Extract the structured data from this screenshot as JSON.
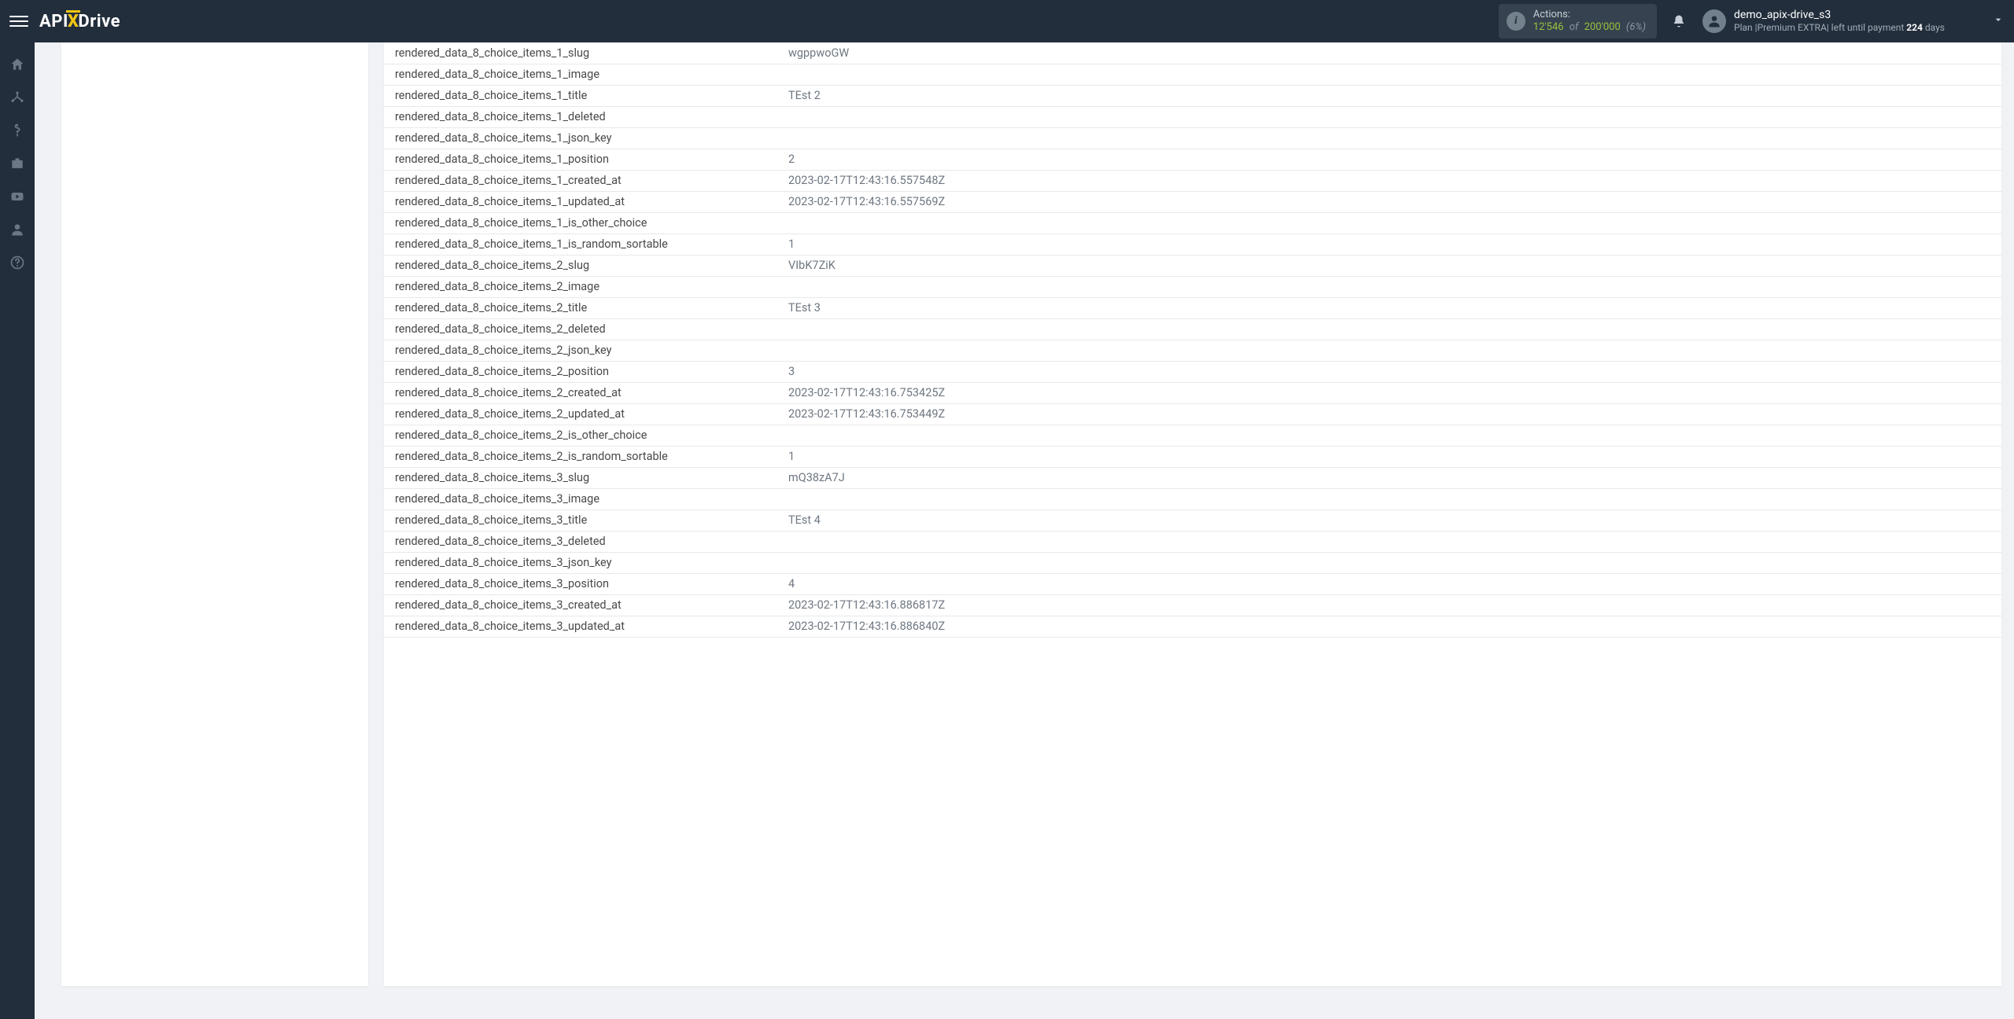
{
  "header": {
    "logo": {
      "api": "API",
      "x": "X",
      "drive": "Drive"
    },
    "actions": {
      "label": "Actions:",
      "count": "12'546",
      "of": "of",
      "total": "200'000",
      "pct": "(6%)"
    },
    "user": {
      "name": "demo_apix-drive_s3",
      "plan_prefix": "Plan |",
      "plan_name": "Premium EXTRA",
      "plan_suffix": "| left until payment ",
      "days_num": "224",
      "days_word": " days"
    }
  },
  "rows": [
    {
      "key": "rendered_data_8_choice_items_1_slug",
      "value": "wgppwoGW"
    },
    {
      "key": "rendered_data_8_choice_items_1_image",
      "value": ""
    },
    {
      "key": "rendered_data_8_choice_items_1_title",
      "value": "TEst 2"
    },
    {
      "key": "rendered_data_8_choice_items_1_deleted",
      "value": ""
    },
    {
      "key": "rendered_data_8_choice_items_1_json_key",
      "value": ""
    },
    {
      "key": "rendered_data_8_choice_items_1_position",
      "value": "2"
    },
    {
      "key": "rendered_data_8_choice_items_1_created_at",
      "value": "2023-02-17T12:43:16.557548Z"
    },
    {
      "key": "rendered_data_8_choice_items_1_updated_at",
      "value": "2023-02-17T12:43:16.557569Z"
    },
    {
      "key": "rendered_data_8_choice_items_1_is_other_choice",
      "value": ""
    },
    {
      "key": "rendered_data_8_choice_items_1_is_random_sortable",
      "value": "1"
    },
    {
      "key": "rendered_data_8_choice_items_2_slug",
      "value": "VIbK7ZiK"
    },
    {
      "key": "rendered_data_8_choice_items_2_image",
      "value": ""
    },
    {
      "key": "rendered_data_8_choice_items_2_title",
      "value": "TEst 3"
    },
    {
      "key": "rendered_data_8_choice_items_2_deleted",
      "value": ""
    },
    {
      "key": "rendered_data_8_choice_items_2_json_key",
      "value": ""
    },
    {
      "key": "rendered_data_8_choice_items_2_position",
      "value": "3"
    },
    {
      "key": "rendered_data_8_choice_items_2_created_at",
      "value": "2023-02-17T12:43:16.753425Z"
    },
    {
      "key": "rendered_data_8_choice_items_2_updated_at",
      "value": "2023-02-17T12:43:16.753449Z"
    },
    {
      "key": "rendered_data_8_choice_items_2_is_other_choice",
      "value": ""
    },
    {
      "key": "rendered_data_8_choice_items_2_is_random_sortable",
      "value": "1"
    },
    {
      "key": "rendered_data_8_choice_items_3_slug",
      "value": "mQ38zA7J"
    },
    {
      "key": "rendered_data_8_choice_items_3_image",
      "value": ""
    },
    {
      "key": "rendered_data_8_choice_items_3_title",
      "value": "TEst 4"
    },
    {
      "key": "rendered_data_8_choice_items_3_deleted",
      "value": ""
    },
    {
      "key": "rendered_data_8_choice_items_3_json_key",
      "value": ""
    },
    {
      "key": "rendered_data_8_choice_items_3_position",
      "value": "4"
    },
    {
      "key": "rendered_data_8_choice_items_3_created_at",
      "value": "2023-02-17T12:43:16.886817Z"
    },
    {
      "key": "rendered_data_8_choice_items_3_updated_at",
      "value": "2023-02-17T12:43:16.886840Z"
    }
  ]
}
